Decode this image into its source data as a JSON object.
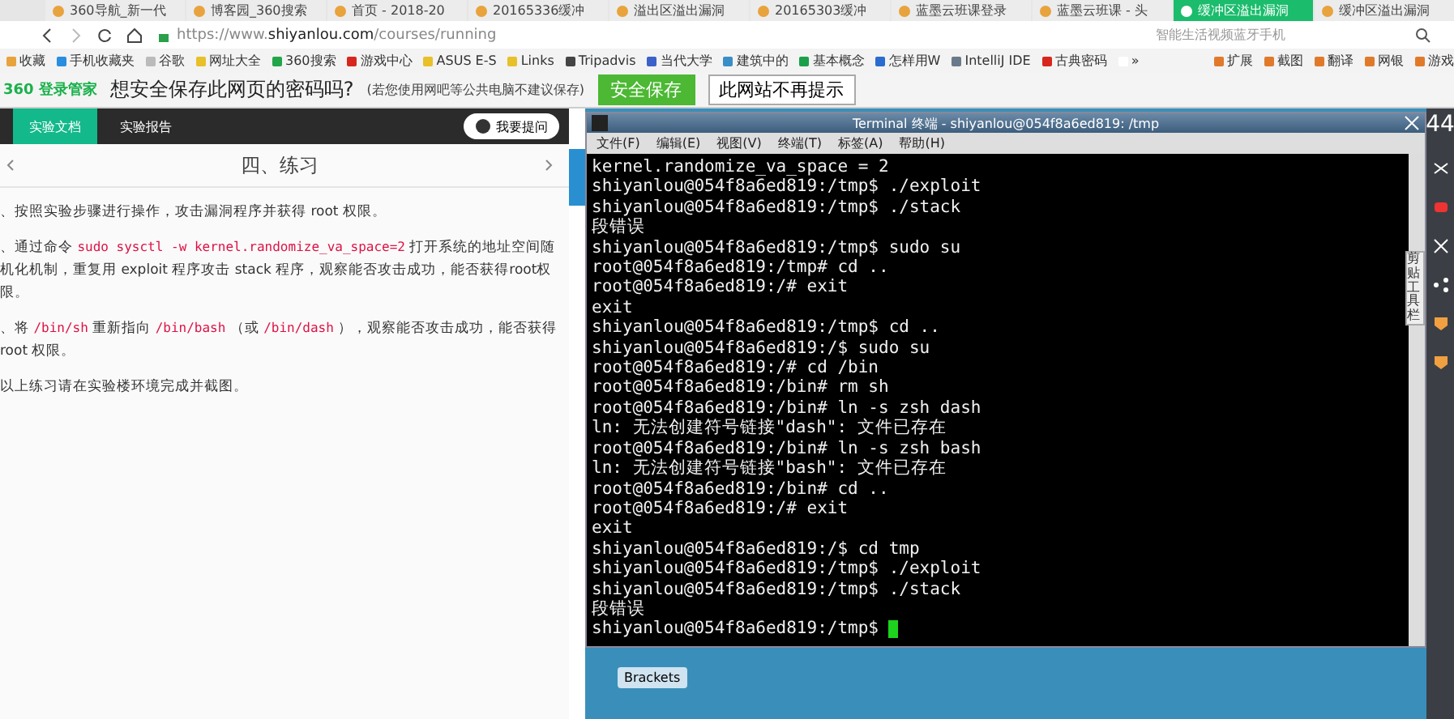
{
  "browser": {
    "tabs": [
      {
        "title": "360导航_新一代",
        "selected": false
      },
      {
        "title": "博客园_360搜索",
        "selected": false
      },
      {
        "title": "首页 - 2018-20",
        "selected": false
      },
      {
        "title": "20165336缓冲",
        "selected": false
      },
      {
        "title": "溢出区溢出漏洞",
        "selected": false
      },
      {
        "title": "20165303缓冲",
        "selected": false
      },
      {
        "title": "蓝墨云班课登录",
        "selected": false
      },
      {
        "title": "蓝墨云班课 - 头",
        "selected": false
      },
      {
        "title": "缓冲区溢出漏洞",
        "selected": true
      },
      {
        "title": "缓冲区溢出漏洞",
        "selected": false
      }
    ],
    "url_scheme": "https://www.",
    "url_host": "shiyanlou.com",
    "url_path": "/courses/running",
    "search_placeholder": "智能生活视频蓝牙手机",
    "bookmarks": [
      "收藏",
      "手机收藏夹",
      "谷歌",
      "网址大全",
      "360搜索",
      "游戏中心",
      "ASUS E-S",
      "Links",
      "Tripadvis",
      "当代大学",
      "建筑中的",
      "基本概念",
      "怎样用W",
      "IntelliJ IDE",
      "古典密码",
      "»"
    ],
    "tools": [
      "扩展",
      "截图",
      "翻译",
      "网银",
      "游戏"
    ],
    "password_bar": {
      "brand": "360 登录管家",
      "question": "想安全保存此网页的密码吗?",
      "note": "(若您使用网吧等公共电脑不建议保存)",
      "save": "安全保存",
      "never": "此网站不再提示"
    }
  },
  "lab": {
    "nav_tabs": [
      {
        "label": "实验文档",
        "selected": true
      },
      {
        "label": "实验报告",
        "selected": false
      }
    ],
    "ask_button": "我要提问",
    "heading": "四、练习",
    "items": [
      [
        {
          "kind": "text",
          "text": "、按照实验步骤进行操作，攻击漏洞程序并获得 root 权限。"
        }
      ],
      [
        {
          "kind": "text",
          "text": "、通过命令 "
        },
        {
          "kind": "code",
          "text": "sudo sysctl -w kernel.randomize_va_space=2"
        },
        {
          "kind": "text",
          "text": " 打开系统的地址空间随机化机制，重复用 exploit 程序攻击 stack 程序，观察能否攻击成功，能否获得root权限。"
        }
      ],
      [
        {
          "kind": "text",
          "text": "、将 "
        },
        {
          "kind": "code",
          "text": "/bin/sh"
        },
        {
          "kind": "text",
          "text": " 重新指向 "
        },
        {
          "kind": "code",
          "text": "/bin/bash"
        },
        {
          "kind": "text",
          "text": " （或 "
        },
        {
          "kind": "code",
          "text": "/bin/dash"
        },
        {
          "kind": "text",
          "text": " ），观察能否攻击成功，能否获得 root 权限。"
        }
      ],
      [
        {
          "kind": "text",
          "text": "以上练习请在实验楼环境完成并截图。"
        }
      ]
    ]
  },
  "terminal": {
    "title": "Terminal 终端 - shiyanlou@054f8a6ed819: /tmp",
    "menu": [
      "文件(F)",
      "编辑(E)",
      "视图(V)",
      "终端(T)",
      "标签(A)",
      "帮助(H)"
    ],
    "lines": [
      "kernel.randomize_va_space = 2",
      "shiyanlou@054f8a6ed819:/tmp$ ./exploit",
      "shiyanlou@054f8a6ed819:/tmp$ ./stack",
      "段错误",
      "shiyanlou@054f8a6ed819:/tmp$ sudo su",
      "root@054f8a6ed819:/tmp# cd ..",
      "root@054f8a6ed819:/# exit",
      "exit",
      "shiyanlou@054f8a6ed819:/tmp$ cd ..",
      "shiyanlou@054f8a6ed819:/$ sudo su",
      "root@054f8a6ed819:/# cd /bin",
      "root@054f8a6ed819:/bin# rm sh",
      "root@054f8a6ed819:/bin# ln -s zsh dash",
      "ln: 无法创建符号链接\"dash\": 文件已存在",
      "root@054f8a6ed819:/bin# ln -s zsh bash",
      "ln: 无法创建符号链接\"bash\": 文件已存在",
      "root@054f8a6ed819:/bin# cd ..",
      "root@054f8a6ed819:/# exit",
      "exit",
      "shiyanlou@054f8a6ed819:/$ cd tmp",
      "shiyanlou@054f8a6ed819:/tmp$ ./exploit",
      "shiyanlou@054f8a6ed819:/tmp$ ./stack",
      "段错误"
    ],
    "prompt": "shiyanlou@054f8a6ed819:/tmp$ ",
    "desktop_button": "Brackets",
    "toolbar_tab": "剪贴工具栏"
  },
  "side": {
    "counter": "44"
  }
}
